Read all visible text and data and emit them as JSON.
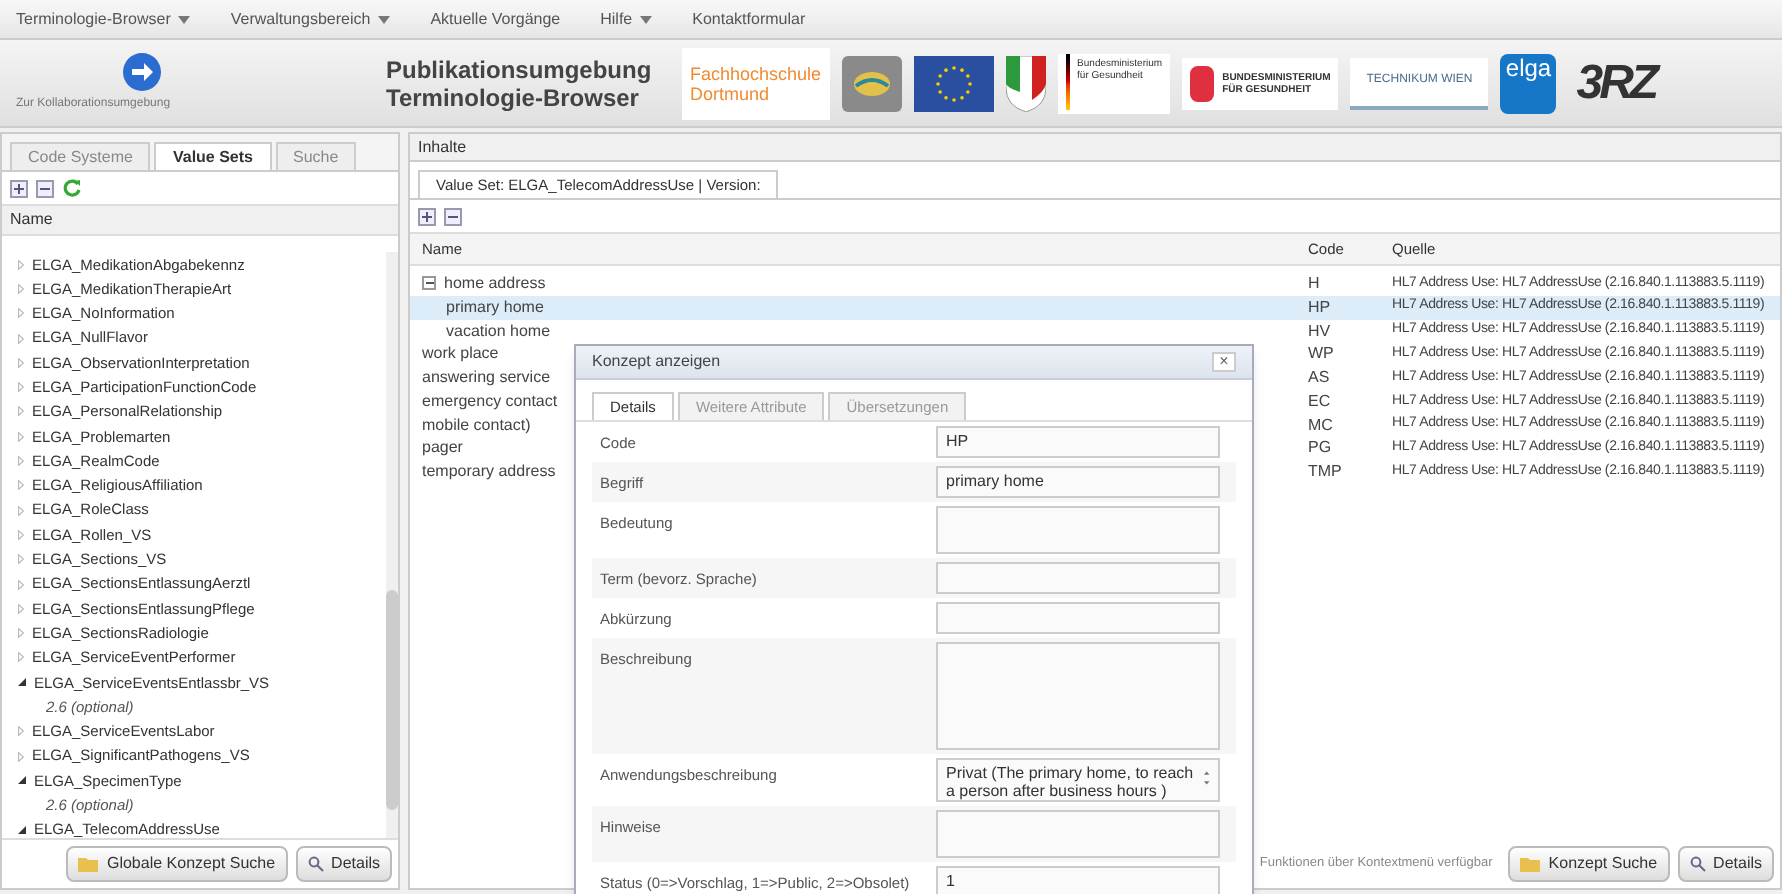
{
  "menu": [
    {
      "label": "Terminologie-Browser",
      "dropdown": true
    },
    {
      "label": "Verwaltungsbereich",
      "dropdown": true
    },
    {
      "label": "Aktuelle Vorgänge",
      "dropdown": false
    },
    {
      "label": "Hilfe",
      "dropdown": true
    },
    {
      "label": "Kontaktformular",
      "dropdown": false
    }
  ],
  "header": {
    "collab_link": "Zur Kollaborationsumgebung",
    "title_lines": [
      "Publikationsumgebung",
      "Terminologie-Browser"
    ],
    "logos": [
      {
        "kind": "fh",
        "lines": [
          "Fachhochschule",
          "Dortmund"
        ]
      },
      {
        "kind": "seal"
      },
      {
        "kind": "eu"
      },
      {
        "kind": "crest"
      },
      {
        "kind": "bmg",
        "lines": [
          "Bundesministerium",
          "für Gesundheit"
        ]
      },
      {
        "kind": "bmg_red",
        "lines": [
          "BUNDESMINISTERIUM",
          "FÜR GESUNDHEIT"
        ]
      },
      {
        "kind": "technikum",
        "lines": [
          "TECHNIKUM WIEN"
        ]
      },
      {
        "kind": "elga",
        "lines": [
          "elga"
        ]
      },
      {
        "kind": "brz",
        "lines": [
          "3RZ"
        ]
      }
    ]
  },
  "left": {
    "tabs": [
      {
        "label": "Code Systeme",
        "selected": false
      },
      {
        "label": "Value Sets",
        "selected": true
      },
      {
        "label": "Suche",
        "selected": false
      }
    ],
    "column": "Name",
    "items": [
      {
        "label": "ELGA_MedikationAbgabekennz",
        "expanded": false
      },
      {
        "label": "ELGA_MedikationTherapieArt",
        "expanded": false
      },
      {
        "label": "ELGA_NoInformation",
        "expanded": false
      },
      {
        "label": "ELGA_NullFlavor",
        "expanded": false
      },
      {
        "label": "ELGA_ObservationInterpretation",
        "expanded": false
      },
      {
        "label": "ELGA_ParticipationFunctionCode",
        "expanded": false
      },
      {
        "label": "ELGA_PersonalRelationship",
        "expanded": false
      },
      {
        "label": "ELGA_Problemarten",
        "expanded": false
      },
      {
        "label": "ELGA_RealmCode",
        "expanded": false
      },
      {
        "label": "ELGA_ReligiousAffiliation",
        "expanded": false
      },
      {
        "label": "ELGA_RoleClass",
        "expanded": false
      },
      {
        "label": "ELGA_Rollen_VS",
        "expanded": false
      },
      {
        "label": "ELGA_Sections_VS",
        "expanded": false
      },
      {
        "label": "ELGA_SectionsEntlassungAerztl",
        "expanded": false
      },
      {
        "label": "ELGA_SectionsEntlassungPflege",
        "expanded": false
      },
      {
        "label": "ELGA_SectionsRadiologie",
        "expanded": false
      },
      {
        "label": "ELGA_ServiceEventPerformer",
        "expanded": false
      },
      {
        "label": "ELGA_ServiceEventsEntlassbr_VS",
        "expanded": true,
        "children": [
          {
            "label": "2.6 (optional)"
          }
        ]
      },
      {
        "label": "ELGA_ServiceEventsLabor",
        "expanded": false
      },
      {
        "label": "ELGA_SignificantPathogens_VS",
        "expanded": false
      },
      {
        "label": "ELGA_SpecimenType",
        "expanded": true,
        "children": [
          {
            "label": "2.6 (optional)"
          }
        ]
      },
      {
        "label": "ELGA_TelecomAddressUse",
        "expanded": true
      }
    ],
    "buttons": [
      "Globale Konzept Suche",
      "Details"
    ]
  },
  "right": {
    "title": "Inhalte",
    "tabs": [
      {
        "label": "Value Set: ELGA_TelecomAddressUse | Version:",
        "selected": true
      }
    ],
    "columns": [
      "Name",
      "Code",
      "Quelle"
    ],
    "rows": [
      {
        "name": "home address",
        "code": "H",
        "source": "HL7 Address Use: HL7 AddressUse (2.16.840.1.113883.5.1119)",
        "selected": false,
        "expanded": true,
        "children": [
          {
            "name": "primary home",
            "code": "HP",
            "source": "HL7 Address Use: HL7 AddressUse (2.16.840.1.113883.5.1119)",
            "selected": true
          },
          {
            "name": "vacation home",
            "code": "HV",
            "source": "HL7 Address Use: HL7 AddressUse (2.16.840.1.113883.5.1119)",
            "selected": false
          }
        ]
      },
      {
        "name": "work place",
        "code": "WP",
        "source": "HL7 Address Use: HL7 AddressUse (2.16.840.1.113883.5.1119)",
        "selected": false
      },
      {
        "name": "answering service",
        "code": "AS",
        "source": "HL7 Address Use: HL7 AddressUse (2.16.840.1.113883.5.1119)",
        "selected": false
      },
      {
        "name": "emergency contact",
        "code": "EC",
        "source": "HL7 Address Use: HL7 AddressUse (2.16.840.1.113883.5.1119)",
        "selected": false
      },
      {
        "name": "mobile contact)",
        "code": "MC",
        "source": "HL7 Address Use: HL7 AddressUse (2.16.840.1.113883.5.1119)",
        "selected": false
      },
      {
        "name": "pager",
        "code": "PG",
        "source": "HL7 Address Use: HL7 AddressUse (2.16.840.1.113883.5.1119)",
        "selected": false
      },
      {
        "name": "temporary address",
        "code": "TMP",
        "source": "HL7 Address Use: HL7 AddressUse (2.16.840.1.113883.5.1119)",
        "selected": false
      }
    ],
    "footer_text": "Funktionen über Kontextmenü verfügbar",
    "buttons": [
      "Konzept Suche",
      "Details"
    ]
  },
  "dialog": {
    "title": "Konzept anzeigen",
    "close": "×",
    "tabs": [
      {
        "label": "Details",
        "selected": true
      },
      {
        "label": "Weitere Attribute",
        "selected": false
      },
      {
        "label": "Übersetzungen",
        "selected": false
      }
    ],
    "fields": [
      {
        "label": "Code",
        "kind": "input",
        "value": "HP"
      },
      {
        "label": "Begriff",
        "kind": "input",
        "value": "primary home"
      },
      {
        "label": "Bedeutung",
        "kind": "textarea"
      },
      {
        "label": "Term (bevorz. Sprache)",
        "kind": "input"
      },
      {
        "label": "Abkürzung",
        "kind": "input"
      },
      {
        "label": "Beschreibung",
        "kind": "bigarea"
      },
      {
        "label": "Anwendungsbeschreibung",
        "kind": "spin",
        "value": "Privat (The primary home, to reach a person after business hours )"
      },
      {
        "label": "Hinweise",
        "kind": "textarea"
      },
      {
        "label": "Status (0=>Vorschlag, 1=>Public, 2=>Obsolet)",
        "kind": "input",
        "value": "1"
      }
    ]
  }
}
